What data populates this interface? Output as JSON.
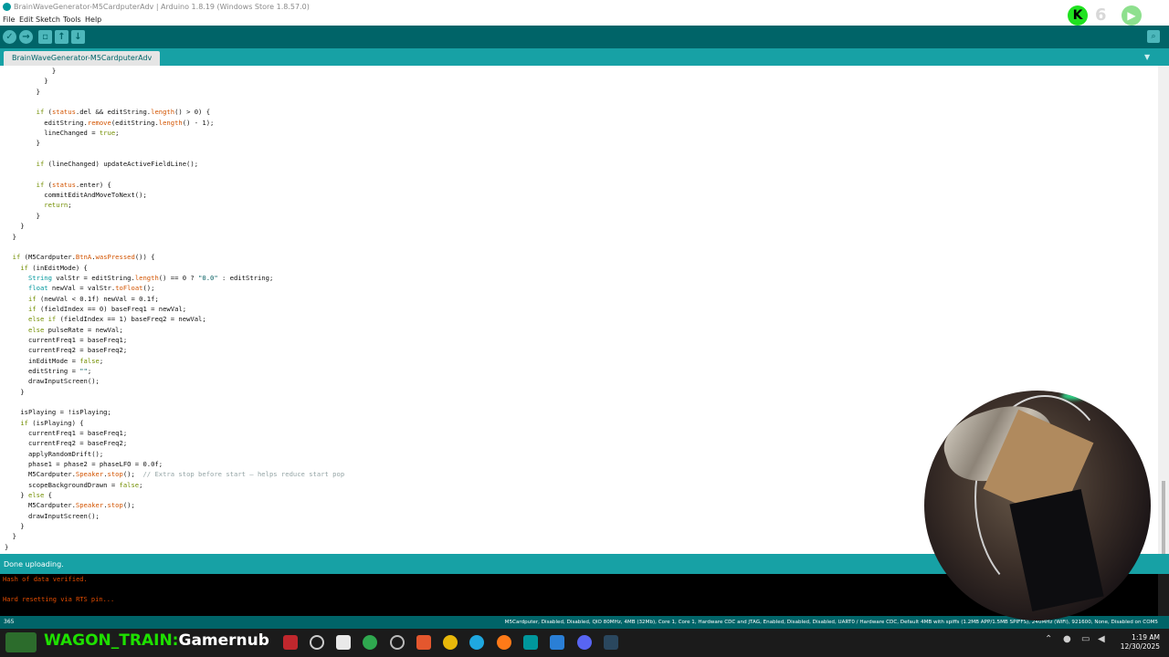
{
  "window": {
    "title": "BrainWaveGenerator-M5CardputerAdv | Arduino 1.8.19 (Windows Store 1.8.57.0)"
  },
  "menu": [
    "File",
    "Edit",
    "Sketch",
    "Tools",
    "Help"
  ],
  "toolbar": {
    "verify_icon": "check-icon",
    "upload_icon": "arrow-right-icon",
    "new_icon": "new-file-icon",
    "open_icon": "open-arrow-up-icon",
    "save_icon": "save-arrow-down-icon",
    "serial_monitor_icon": "magnifier-icon"
  },
  "tab": {
    "label": "BrainWaveGenerator-M5CardputerAdv"
  },
  "status": {
    "message": "Done uploading."
  },
  "console": {
    "lines": [
      "Hash of data verified.",
      "",
      "Hard resetting via RTS pin..."
    ]
  },
  "info": {
    "line_number": "365",
    "board": "M5Cardputer, Disabled, Disabled, QIO 80MHz, 4MB (32Mb), Core 1, Core 1, Hardware CDC and JTAG, Enabled, Disabled, Disabled, UART0 / Hardware CDC, Default 4MB with spiffs (1.2MB APP/1.5MB SPIFFS), 240MHz (WiFi), 921600, None, Disabled on COM5"
  },
  "overlay": {
    "channel_text_a": "WAGON_TRAIN:",
    "channel_text_b": "Gamernub"
  },
  "clock": {
    "time": "1:19 AM",
    "date": "12/30/2025"
  },
  "code": [
    "            }",
    "          }",
    "        }",
    "",
    "        if (status.del && editString.length() > 0) {",
    "          editString.remove(editString.length() - 1);",
    "          lineChanged = true;",
    "        }",
    "",
    "        if (lineChanged) updateActiveFieldLine();",
    "",
    "        if (status.enter) {",
    "          commitEditAndMoveToNext();",
    "          return;",
    "        }",
    "    }",
    "  }",
    "",
    "  if (M5Cardputer.BtnA.wasPressed()) {",
    "    if (inEditMode) {",
    "      String valStr = editString.length() == 0 ? \"0.0\" : editString;",
    "      float newVal = valStr.toFloat();",
    "      if (newVal < 0.1f) newVal = 0.1f;",
    "      if (fieldIndex == 0) baseFreq1 = newVal;",
    "      else if (fieldIndex == 1) baseFreq2 = newVal;",
    "      else pulseRate = newVal;",
    "      currentFreq1 = baseFreq1;",
    "      currentFreq2 = baseFreq2;",
    "      inEditMode = false;",
    "      editString = \"\";",
    "      drawInputScreen();",
    "    }",
    "",
    "    isPlaying = !isPlaying;",
    "    if (isPlaying) {",
    "      currentFreq1 = baseFreq1;",
    "      currentFreq2 = baseFreq2;",
    "      applyRandomDrift();",
    "      phase1 = phase2 = phaseLFO = 0.0f;",
    "      M5Cardputer.Speaker.stop();  // Extra stop before start — helps reduce start pop",
    "      scopeBackgroundDrawn = false;",
    "    } else {",
    "      M5Cardputer.Speaker.stop();",
    "      drawInputScreen();",
    "    }",
    "  }",
    "}"
  ]
}
